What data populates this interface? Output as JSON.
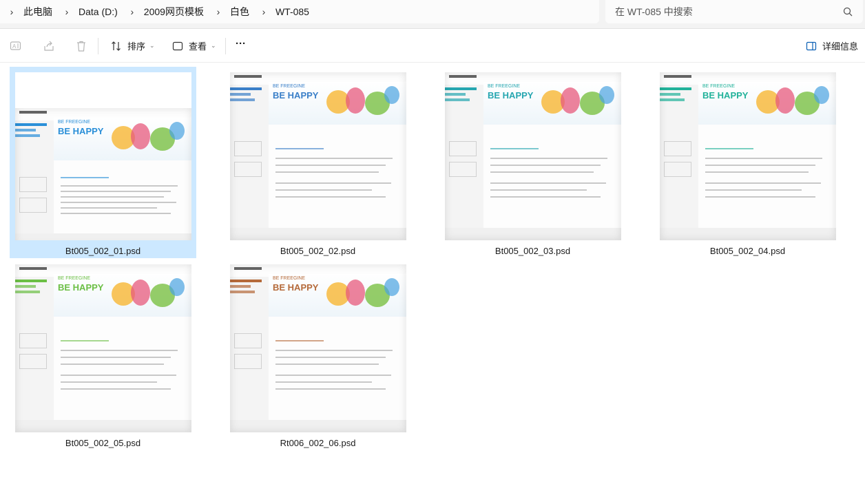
{
  "address": {
    "breadcrumbs": [
      "此电脑",
      "Data (D:)",
      "2009网页模板",
      "白色",
      "WT-085"
    ]
  },
  "search": {
    "placeholder": "在 WT-085 中搜索"
  },
  "toolbar": {
    "sort_label": "排序",
    "view_label": "查看",
    "more_label": "···",
    "details_label": "详细信息"
  },
  "files": [
    {
      "name": "Bt005_002_01.psd",
      "accent": "#2a8fd8",
      "selected": true
    },
    {
      "name": "Bt005_002_02.psd",
      "accent": "#3a7fc8",
      "selected": false
    },
    {
      "name": "Bt005_002_03.psd",
      "accent": "#26a6b0",
      "selected": false
    },
    {
      "name": "Bt005_002_04.psd",
      "accent": "#22b29a",
      "selected": false
    },
    {
      "name": "Bt005_002_05.psd",
      "accent": "#6cbf45",
      "selected": false
    },
    {
      "name": "Rt006_002_06.psd",
      "accent": "#b56a3a",
      "selected": false
    }
  ],
  "thumb_text": {
    "happy": "BE HAPPY",
    "freegine": "BE FREEGINE"
  },
  "colors": {
    "selection": "#cce8ff",
    "toolbar_bg": "#ffffff",
    "address_bg": "#f3f3f3"
  }
}
